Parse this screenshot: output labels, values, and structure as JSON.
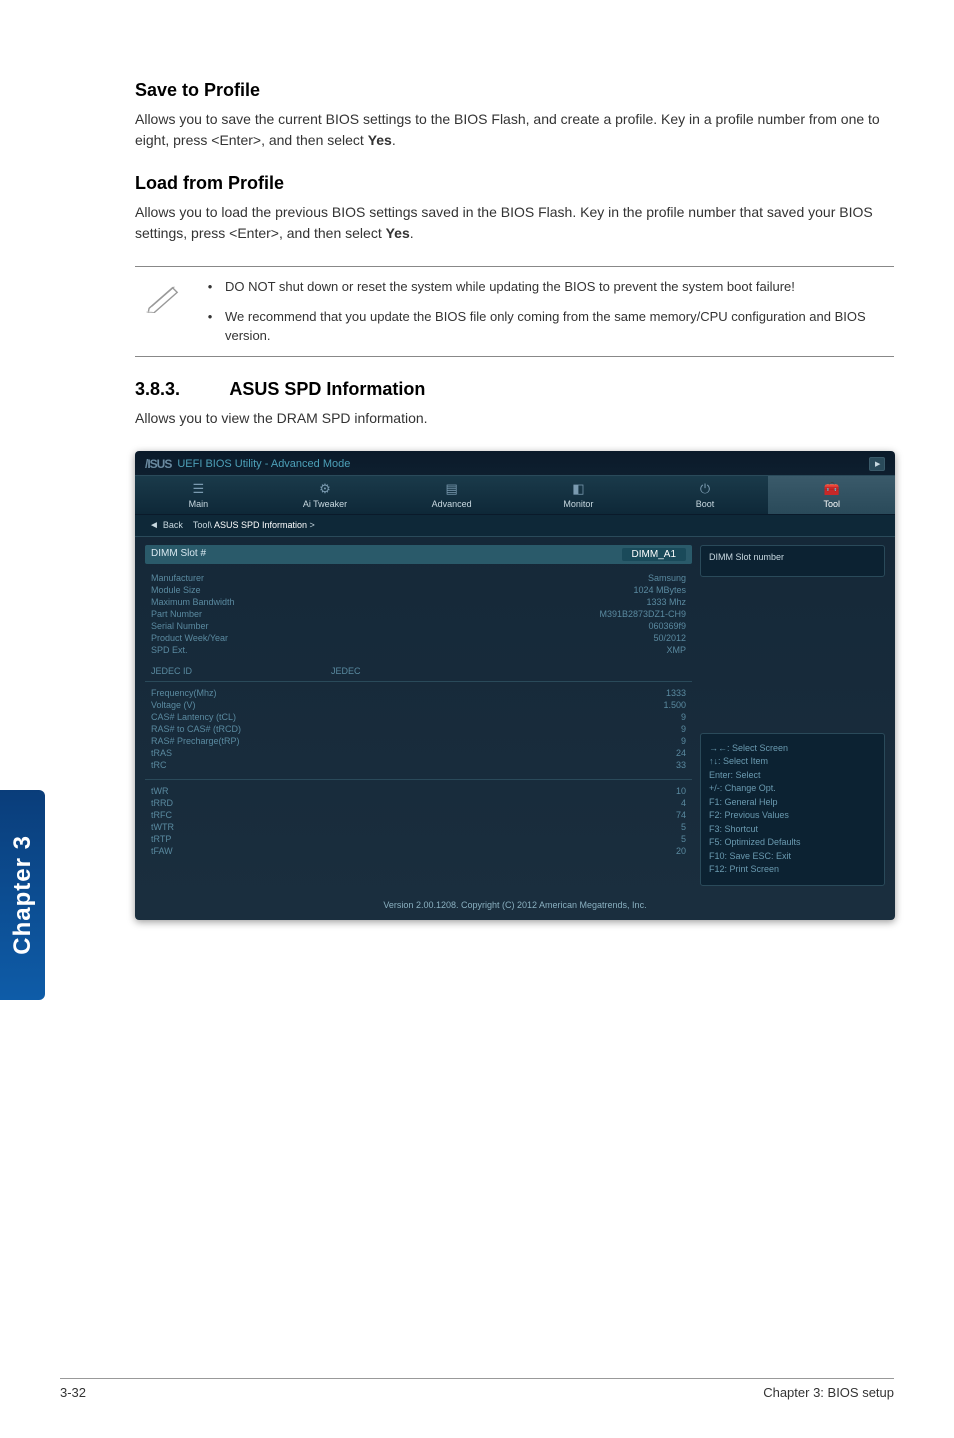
{
  "section1": {
    "title": "Save to Profile",
    "body": "Allows you to save the current BIOS settings to the BIOS Flash, and create a profile. Key in a profile number from one to eight, press <Enter>, and then select Yes."
  },
  "section2": {
    "title": "Load from Profile",
    "body": "Allows you to load the previous BIOS settings saved in the BIOS Flash. Key in the profile number that saved your BIOS settings, press <Enter>, and then select Yes."
  },
  "note": {
    "bullet1": "DO NOT shut down or reset the system while updating the BIOS to prevent the system boot failure!",
    "bullet2": "We recommend that you update the BIOS file only coming from the same memory/CPU configuration and BIOS version."
  },
  "section3": {
    "num": "3.8.3.",
    "title": "ASUS SPD Information",
    "body": "Allows you to view the DRAM SPD information."
  },
  "bios": {
    "title": "UEFI BIOS Utility - Advanced Mode",
    "tabs": [
      {
        "label": "Main",
        "icon": "☰"
      },
      {
        "label": "Ai Tweaker",
        "icon": "⚙"
      },
      {
        "label": "Advanced",
        "icon": "🗄"
      },
      {
        "label": "Monitor",
        "icon": "📊"
      },
      {
        "label": "Boot",
        "icon": "⟳"
      },
      {
        "label": "Tool",
        "icon": "🧰"
      }
    ],
    "back": "Back",
    "breadcrumb_prefix": "Tool\\ ",
    "breadcrumb_main": "ASUS SPD Information",
    "breadcrumb_suffix": " >",
    "dimm_slot_label": "DIMM Slot #",
    "dimm_slot_value": "DIMM_A1",
    "info_rows": [
      {
        "label": "Manufacturer",
        "value": "Samsung"
      },
      {
        "label": "Module Size",
        "value": "1024 MBytes"
      },
      {
        "label": "Maximum Bandwidth",
        "value": "1333 Mhz"
      },
      {
        "label": "Part Number",
        "value": "M391B2873DZ1-CH9"
      },
      {
        "label": "Serial Number",
        "value": "060369f9"
      },
      {
        "label": "Product Week/Year",
        "value": "50/2012"
      },
      {
        "label": "SPD Ext.",
        "value": "XMP"
      }
    ],
    "jedec_header": {
      "col1": "JEDEC ID",
      "col2": "JEDEC"
    },
    "timing_rows1": [
      {
        "label": "Frequency(Mhz)",
        "value": "1333"
      },
      {
        "label": "Voltage (V)",
        "value": "1.500"
      },
      {
        "label": "CAS# Lantency (tCL)",
        "value": "9"
      },
      {
        "label": "RAS# to CAS# (tRCD)",
        "value": "9"
      },
      {
        "label": "RAS# Precharge(tRP)",
        "value": "9"
      },
      {
        "label": "tRAS",
        "value": "24"
      },
      {
        "label": "tRC",
        "value": "33"
      }
    ],
    "timing_rows2": [
      {
        "label": "tWR",
        "value": "10"
      },
      {
        "label": "tRRD",
        "value": "4"
      },
      {
        "label": "tRFC",
        "value": "74"
      },
      {
        "label": "tWTR",
        "value": "5"
      },
      {
        "label": "tRTP",
        "value": "5"
      },
      {
        "label": "tFAW",
        "value": "20"
      }
    ],
    "help_text": "DIMM Slot number",
    "help_keys": [
      "→←: Select Screen",
      "↑↓: Select Item",
      "Enter: Select",
      "+/-: Change Opt.",
      "F1: General Help",
      "F2: Previous Values",
      "F3: Shortcut",
      "F5: Optimized Defaults",
      "F10: Save   ESC: Exit",
      "F12: Print Screen"
    ],
    "footer": "Version 2.00.1208.  Copyright (C) 2012 American Megatrends, Inc."
  },
  "sidebar": "Chapter 3",
  "footer": {
    "left": "3-32",
    "right": "Chapter 3: BIOS setup"
  }
}
